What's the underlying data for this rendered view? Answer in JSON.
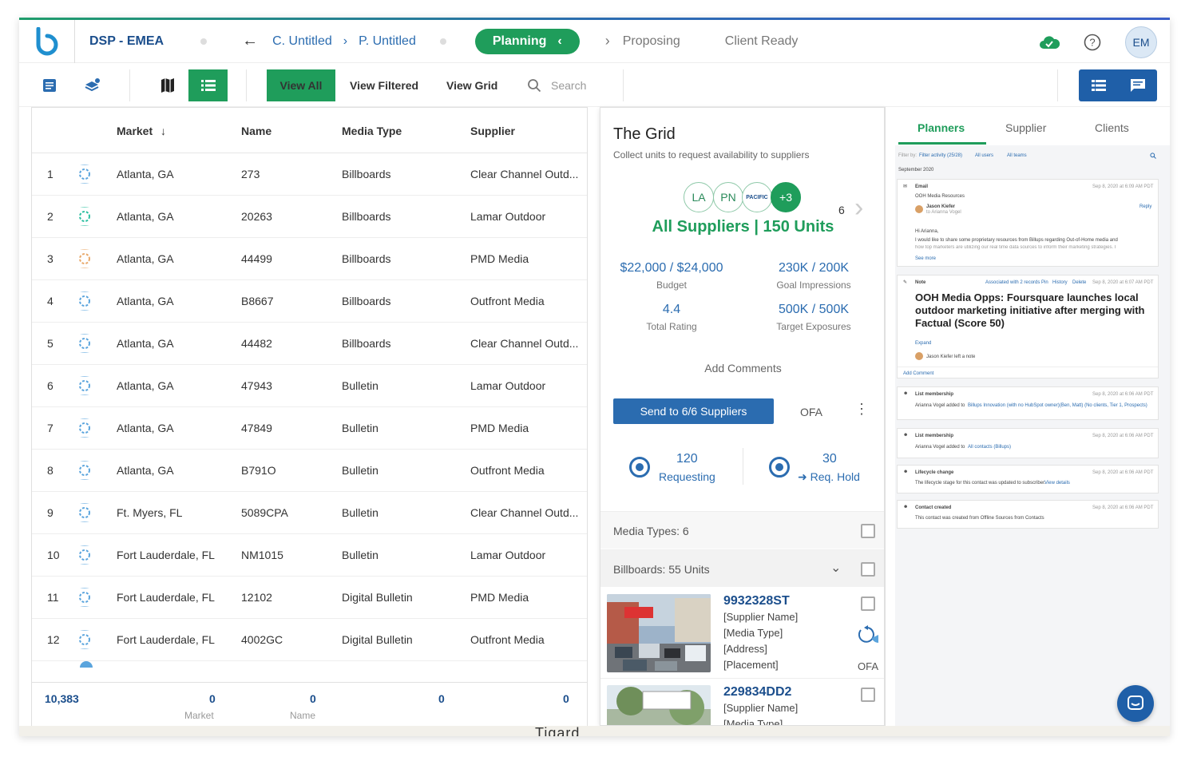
{
  "header": {
    "title": "DSP - EMEA",
    "breadcrumb_1": "C. Untitled",
    "breadcrumb_2": "P. Untitled",
    "stage_active": "Planning",
    "stage_2": "Proposing",
    "stage_3": "Client Ready",
    "avatar_initials": "EM"
  },
  "toolbar": {
    "view_all": "View All",
    "view_filtered": "View Filtered",
    "view_grid": "View Grid",
    "search_placeholder": "Search"
  },
  "table": {
    "columns": [
      "Market",
      "Name",
      "Media Type",
      "Supplier"
    ],
    "rows": [
      {
        "num": "1",
        "market": "Atlanta, GA",
        "name": "273",
        "type": "Billboards",
        "supplier": "Clear Channel Outd..."
      },
      {
        "num": "2",
        "market": "Atlanta, GA",
        "name": "20263",
        "type": "Billboards",
        "supplier": "Lamar Outdoor"
      },
      {
        "num": "3",
        "market": "Atlanta, GA",
        "name": "44499",
        "type": "Billboards",
        "supplier": "PMD Media"
      },
      {
        "num": "4",
        "market": "Atlanta, GA",
        "name": "B8667",
        "type": "Billboards",
        "supplier": "Outfront Media"
      },
      {
        "num": "5",
        "market": "Atlanta, GA",
        "name": "44482",
        "type": "Billboards",
        "supplier": "Clear Channel Outd..."
      },
      {
        "num": "6",
        "market": "Atlanta, GA",
        "name": "47943",
        "type": "Bulletin",
        "supplier": "Lamar Outdoor"
      },
      {
        "num": "7",
        "market": "Atlanta, GA",
        "name": "47849",
        "type": "Bulletin",
        "supplier": "PMD Media"
      },
      {
        "num": "8",
        "market": "Atlanta, GA",
        "name": "B791O",
        "type": "Bulletin",
        "supplier": "Outfront Media"
      },
      {
        "num": "9",
        "market": "Ft. Myers, FL",
        "name": "5089CPA",
        "type": "Bulletin",
        "supplier": "Clear Channel Outd..."
      },
      {
        "num": "10",
        "market": "Fort Lauderdale, FL",
        "name": "NM1015",
        "type": "Bulletin",
        "supplier": "Lamar Outdoor"
      },
      {
        "num": "11",
        "market": "Fort Lauderdale, FL",
        "name": "12102",
        "type": "Digital Bulletin",
        "supplier": "PMD Media"
      },
      {
        "num": "12",
        "market": "Fort Lauderdale, FL",
        "name": "4002GC",
        "type": "Digital Bulletin",
        "supplier": "Outfront Media"
      }
    ],
    "footer": {
      "total": "10,383",
      "market_count": "0",
      "market_label": "Market",
      "name_count": "0",
      "name_label": "Name",
      "type_count": "0",
      "supplier_count": "0"
    }
  },
  "grid": {
    "title": "The Grid",
    "subtitle": "Collect units to request availability to suppliers",
    "bubbles": [
      "LA",
      "PN",
      "PACIFIC",
      "+3"
    ],
    "count_right": "6",
    "summary": "All Suppliers | 150 Units",
    "budget_value": "$22,000 / $24,000",
    "budget_label": "Budget",
    "impressions_value": "230K / 200K",
    "impressions_label": "Goal Impressions",
    "rating_value": "4.4",
    "rating_label": "Total Rating",
    "exposures_value": "500K / 500K",
    "exposures_label": "Target Exposures",
    "add_comments": "Add Comments",
    "send_button": "Send to 6/6 Suppliers",
    "ofa": "OFA",
    "requesting_count": "120",
    "requesting_label": "Requesting",
    "hold_count": "30",
    "hold_label": "Req. Hold",
    "media_types": "Media Types: 6",
    "billboards": "Billboards: 55 Units",
    "units": [
      {
        "id": "9932328ST",
        "supplier": "[Supplier Name]",
        "type": "[Media Type]",
        "address": "[Address]",
        "placement": "[Placement]",
        "ofa": "OFA"
      },
      {
        "id": "229834DD2",
        "supplier": "[Supplier Name]",
        "type": "[Media Type]"
      }
    ]
  },
  "right_panel": {
    "tabs": [
      "Planners",
      "Supplier",
      "Clients"
    ],
    "filter_label": "Filter by:",
    "filter_activity": "Filter activity (25/28)",
    "filter_users": "All users",
    "filter_teams": "All teams",
    "month": "September 2020",
    "cards": [
      {
        "kind": "Email",
        "date": "Sep 8, 2020 at 6:09 AM PDT",
        "title": "OOH Media Resources",
        "author": "Jason Kiefer",
        "to": "to Arianna Vogel",
        "reply": "Reply",
        "body1": "Hi Arianna,",
        "body2": "I would like to share some proprietary resources from Billups regarding Out-of-Home media and",
        "body3": "how top marketers are utilizing our real time data sources to inform their marketing strategies. I",
        "more": "See more"
      },
      {
        "kind": "Note",
        "meta": "Associated with 2 records",
        "pin": "Pin",
        "history": "History",
        "delete": "Delete",
        "date": "Sep 8, 2020 at 6:07 AM PDT",
        "headline": "OOH Media Opps: Foursquare launches local outdoor marketing initiative after merging with Factual (Score 50)",
        "expand": "Expand",
        "author": "Jason Kiefer left a note",
        "add_comment": "Add Comment"
      },
      {
        "kind": "List membership",
        "date": "Sep 8, 2020 at 6:06 AM PDT",
        "body": "Arianna Vogel added to",
        "link": "Billups Innovation (with no HubSpot owner)(Ben, Matt) (No clients, Tier 1, Prospects)"
      },
      {
        "kind": "List membership",
        "date": "Sep 8, 2020 at 6:06 AM PDT",
        "body": "Arianna Vogel added to",
        "link": "All contacts (Billups)"
      },
      {
        "kind": "Lifecycle change",
        "date": "Sep 8, 2020 at 6:06 AM PDT",
        "body": "The lifecycle stage for this contact was updated to subscriber.",
        "link": "View details"
      },
      {
        "kind": "Contact created",
        "date": "Sep 8, 2020 at 6:06 AM PDT",
        "body": "This contact was created from Offline Sources from Contacts"
      }
    ]
  },
  "map": {
    "label": "Tigard"
  },
  "colors": {
    "green": "#1f9d5b",
    "blue": "#2b6cb0",
    "navy": "#1b4e8c"
  }
}
